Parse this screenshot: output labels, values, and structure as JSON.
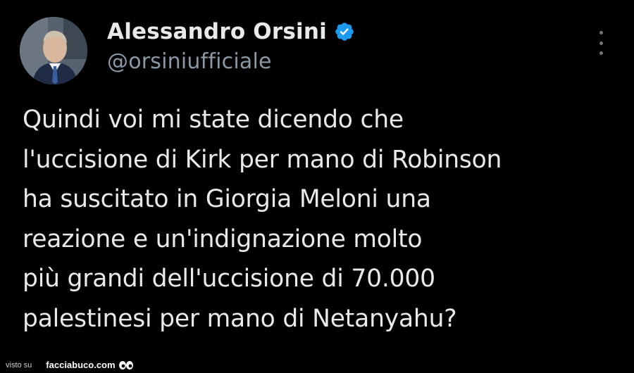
{
  "author": {
    "display_name": "Alessandro Orsini",
    "handle": "@orsiniufficiale",
    "verified": true
  },
  "tweet": {
    "text": "Quindi voi mi state dicendo che\nl'uccisione di Kirk per mano di Robinson\nha suscitato in Giorgia Meloni una\nreazione e un'indignazione molto\npiù grandi dell'uccisione di 70.000\npalestinesi per mano di Netanyahu?"
  },
  "footer": {
    "prefix": "visto su",
    "site": "facciabuco.com"
  },
  "colors": {
    "background": "#000000",
    "text": "#e7e9ea",
    "secondary": "#8b98a5",
    "verified_badge": "#1d9bf0"
  }
}
